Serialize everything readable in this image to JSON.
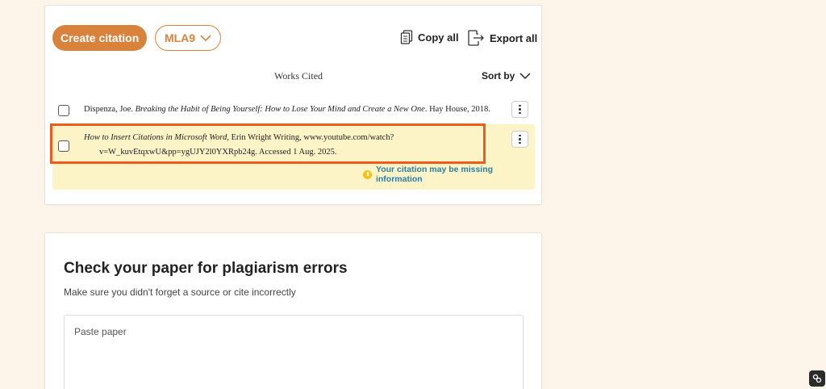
{
  "toolbar": {
    "create_citation_label": "Create citation",
    "citation_style": "MLA9",
    "copy_all_label": "Copy all",
    "export_all_label": "Export all",
    "accent_color": "#d9823b"
  },
  "list": {
    "heading": "Works Cited",
    "sort_label": "Sort by"
  },
  "citations": [
    {
      "author": "Dispenza, Joe. ",
      "title": "Breaking the Habit of Being Yourself: How to Lose Your Mind and Create a New One",
      "rest": ". Hay House, 2018."
    },
    {
      "title": "How to Insert Citations in Microsoft Word",
      "rest_line1": ", Erin Wright Writing, www.youtube.com/watch?",
      "rest_line2": "v=W_kuvEtqxwU&pp=ygUJY2l0YXRpb24g. Accessed 1 Aug. 2025.",
      "warning": "Your citation may be missing information"
    }
  ],
  "plagiarism": {
    "title": "Check your paper for plagiarism errors",
    "subtitle": "Make sure you didn't forget a source or cite incorrectly",
    "placeholder": "Paste paper"
  },
  "icons": {
    "copy": "copy-icon",
    "export": "export-icon",
    "chevron": "chevron-down-icon",
    "more": "more-vertical-icon",
    "warning": "warning-icon"
  }
}
